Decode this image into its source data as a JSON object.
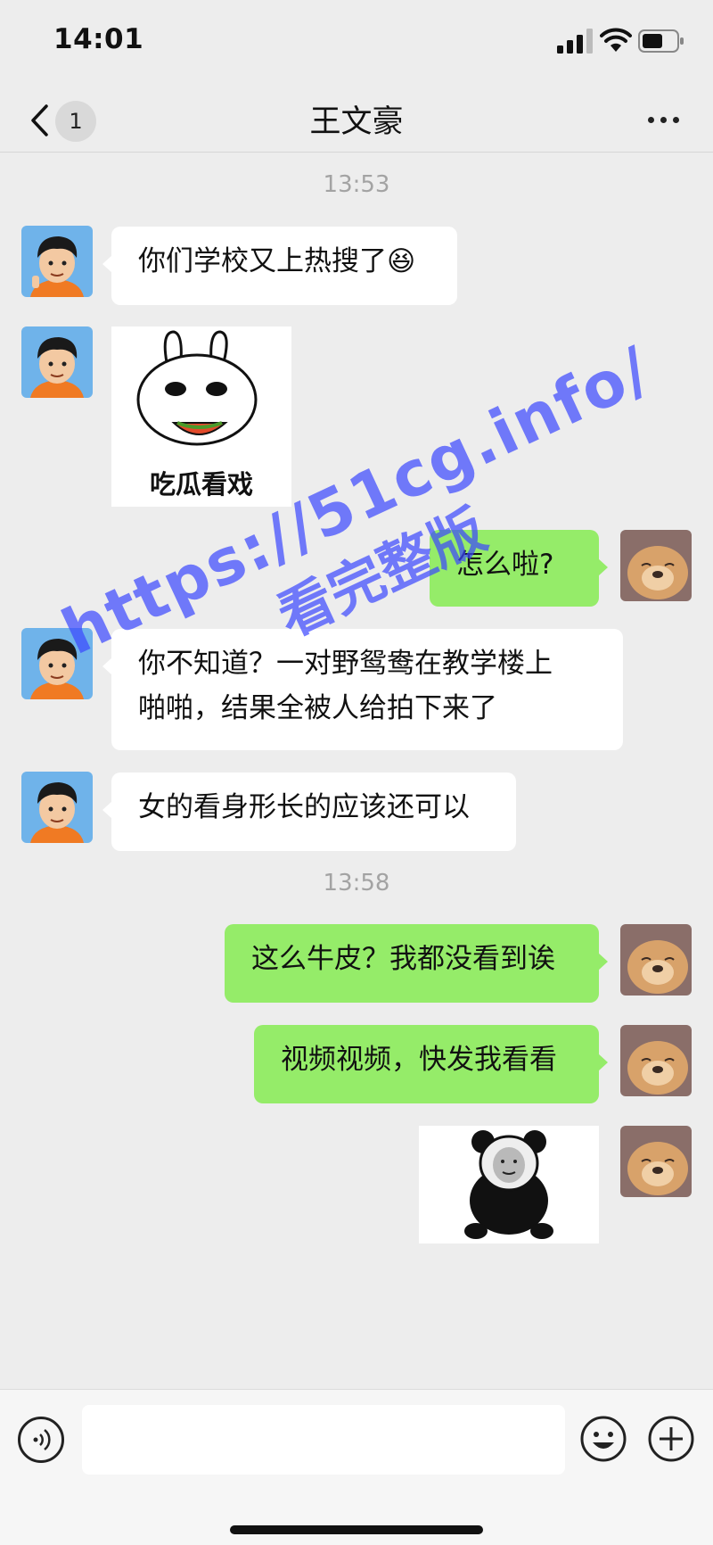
{
  "status": {
    "time": "14:01"
  },
  "header": {
    "unread_count": "1",
    "title": "王文豪"
  },
  "messages": [
    {
      "type": "time",
      "text": "13:53"
    },
    {
      "type": "text",
      "sender": "friend",
      "text": "你们学校又上热搜了😆"
    },
    {
      "type": "sticker",
      "sender": "friend",
      "caption": "吃瓜看戏"
    },
    {
      "type": "text",
      "sender": "me",
      "text": "怎么啦?"
    },
    {
      "type": "text",
      "sender": "friend",
      "line1": "你不知道？一对野鸳鸯在教学楼上",
      "line2": "啪啪，结果全被人给拍下来了"
    },
    {
      "type": "text",
      "sender": "friend",
      "text": "女的看身形长的应该还可以"
    },
    {
      "type": "time",
      "text": "13:58"
    },
    {
      "type": "text",
      "sender": "me",
      "text": "这么牛皮？我都没看到诶"
    },
    {
      "type": "text",
      "sender": "me",
      "text": "视频视频，快发我看看"
    },
    {
      "type": "sticker",
      "sender": "me",
      "caption": ""
    }
  ],
  "watermark": {
    "line1": "https://51cg.info/",
    "line2": "看完整版"
  },
  "colors": {
    "outgoing_bubble": "#95ec69",
    "incoming_bubble": "#ffffff",
    "background": "#ededed",
    "watermark": "#3b47ff"
  },
  "icons": {
    "signal": "signal-icon",
    "wifi": "wifi-icon",
    "battery": "battery-icon",
    "back": "chevron-left-icon",
    "more": "more-dots-icon",
    "voice": "voice-icon",
    "emoji": "emoji-icon",
    "plus": "plus-icon"
  }
}
